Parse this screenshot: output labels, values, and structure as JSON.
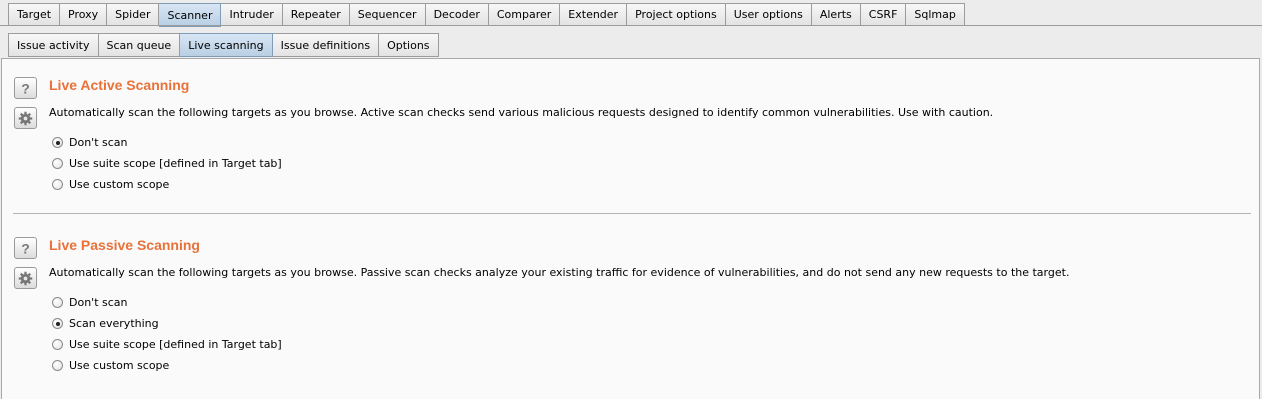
{
  "top_tabs": [
    {
      "label": "Target"
    },
    {
      "label": "Proxy"
    },
    {
      "label": "Spider"
    },
    {
      "label": "Scanner",
      "active": true
    },
    {
      "label": "Intruder"
    },
    {
      "label": "Repeater"
    },
    {
      "label": "Sequencer"
    },
    {
      "label": "Decoder"
    },
    {
      "label": "Comparer"
    },
    {
      "label": "Extender"
    },
    {
      "label": "Project options"
    },
    {
      "label": "User options"
    },
    {
      "label": "Alerts"
    },
    {
      "label": "CSRF"
    },
    {
      "label": "Sqlmap"
    }
  ],
  "sub_tabs": [
    {
      "label": "Issue activity"
    },
    {
      "label": "Scan queue"
    },
    {
      "label": "Live scanning",
      "active": true
    },
    {
      "label": "Issue definitions"
    },
    {
      "label": "Options"
    }
  ],
  "active_scan": {
    "title": "Live Active Scanning",
    "description": "Automatically scan the following targets as you browse. Active scan checks send various malicious requests designed to identify common vulnerabilities. Use with caution.",
    "options": [
      {
        "label": "Don't scan",
        "checked": true
      },
      {
        "label": "Use suite scope [defined in Target tab]",
        "checked": false
      },
      {
        "label": "Use custom scope",
        "checked": false
      }
    ]
  },
  "passive_scan": {
    "title": "Live Passive Scanning",
    "description": "Automatically scan the following targets as you browse. Passive scan checks analyze your existing traffic for evidence of vulnerabilities, and do not send any new requests to the target.",
    "options": [
      {
        "label": "Don't scan",
        "checked": false
      },
      {
        "label": "Scan everything",
        "checked": true
      },
      {
        "label": "Use suite scope [defined in Target tab]",
        "checked": false
      },
      {
        "label": "Use custom scope",
        "checked": false
      }
    ]
  },
  "colors": {
    "accent": "#e8723a",
    "active_tab": "#c8d9ea"
  },
  "icons": {
    "help": "help-icon",
    "settings": "gear-icon"
  }
}
